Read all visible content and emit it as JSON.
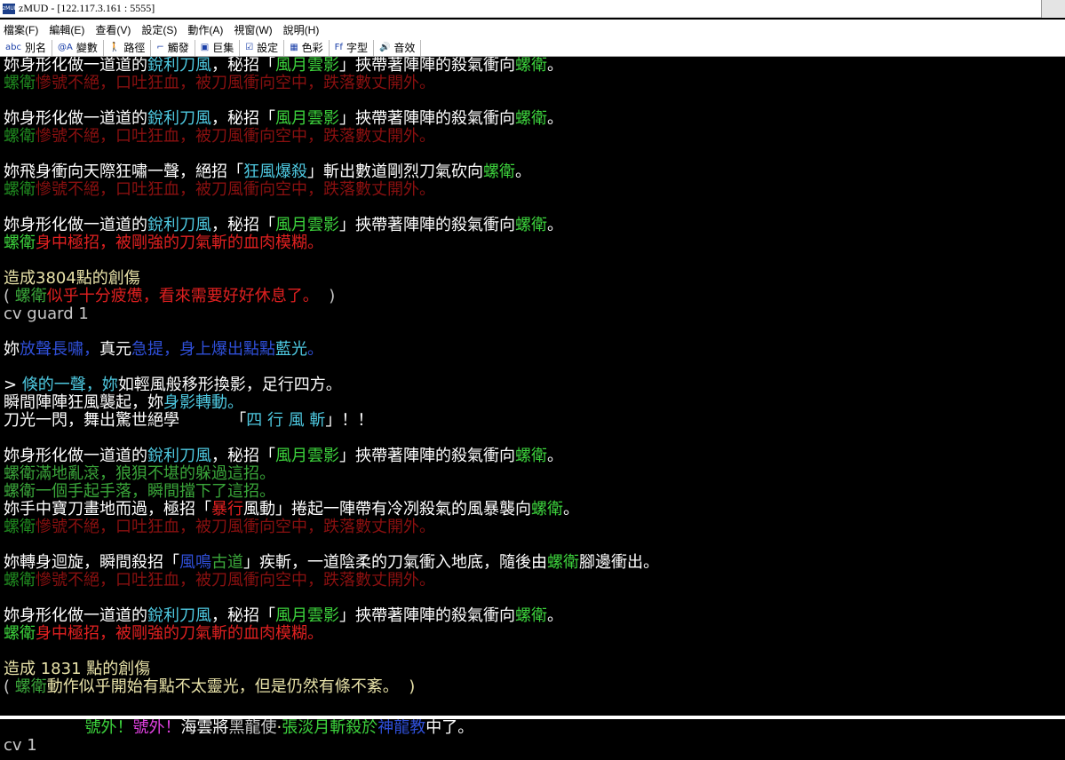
{
  "window": {
    "title": "zMUD - [122.117.3.161 : 5555]",
    "app_icon_text": "zMUD"
  },
  "menu": [
    {
      "label": "檔案(F)"
    },
    {
      "label": "編輯(E)"
    },
    {
      "label": "查看(V)"
    },
    {
      "label": "設定(S)"
    },
    {
      "label": "動作(A)"
    },
    {
      "label": "視窗(W)"
    },
    {
      "label": "說明(H)"
    }
  ],
  "toolbar": [
    {
      "name": "alias-button",
      "icon": "abc",
      "icon_name": "abc-icon",
      "label": "別名"
    },
    {
      "name": "variables-button",
      "icon": "@A",
      "icon_name": "at-a-icon",
      "label": "變數"
    },
    {
      "name": "paths-button",
      "icon": "🚶",
      "icon_name": "walker-icon",
      "label": "路徑"
    },
    {
      "name": "triggers-button",
      "icon": "⌐",
      "icon_name": "gun-icon",
      "label": "觸發"
    },
    {
      "name": "macros-button",
      "icon": "▣",
      "icon_name": "keyboard-icon",
      "label": "巨集"
    },
    {
      "name": "settings-button",
      "icon": "☑",
      "icon_name": "checkbox-icon",
      "label": "設定"
    },
    {
      "name": "colors-button",
      "icon": "▦",
      "icon_name": "color-grid-icon",
      "label": "色彩"
    },
    {
      "name": "fonts-button",
      "icon": "Ff",
      "icon_name": "font-icon",
      "label": "字型"
    },
    {
      "name": "sounds-button",
      "icon": "🔊",
      "icon_name": "speaker-icon",
      "label": "音效"
    }
  ],
  "colors": {
    "white": "#ffffff",
    "cyan": "#4ec8e0",
    "green_bright": "#3cd23c",
    "green": "#3aa63a",
    "darkgreen": "#1f8a1f",
    "red": "#e02020",
    "darkred": "#8a1010",
    "yellow": "#e8e2a8",
    "blue": "#2f4fd8",
    "magenta": "#e040e0",
    "grey": "#c8c8c8"
  },
  "terminal_lines": [
    [
      [
        "妳身形化做一道道的",
        "white"
      ],
      [
        "銳利刀風",
        "cyan"
      ],
      [
        "，秘招「",
        "white"
      ],
      [
        "風月雲影",
        "green_bright"
      ],
      [
        "」挾帶著陣陣的殺氣衝向",
        "white"
      ],
      [
        "螺衛",
        "green_bright"
      ],
      [
        "。",
        "white"
      ]
    ],
    [
      [
        "螺衛",
        "darkgreen"
      ],
      [
        "慘號不絕，口吐狂血，被刀風衝向空中，跌落數丈開外。",
        "darkred"
      ]
    ],
    [],
    [
      [
        "妳身形化做一道道的",
        "white"
      ],
      [
        "銳利刀風",
        "cyan"
      ],
      [
        "，秘招「",
        "white"
      ],
      [
        "風月雲影",
        "green_bright"
      ],
      [
        "」挾帶著陣陣的殺氣衝向",
        "white"
      ],
      [
        "螺衛",
        "green_bright"
      ],
      [
        "。",
        "white"
      ]
    ],
    [
      [
        "螺衛",
        "darkgreen"
      ],
      [
        "慘號不絕，口吐狂血，被刀風衝向空中，跌落數丈開外。",
        "darkred"
      ]
    ],
    [],
    [
      [
        "妳飛身衝向天際狂嘯一聲，絕招「",
        "white"
      ],
      [
        "狂風爆殺",
        "cyan"
      ],
      [
        "」斬出數道剛烈刀氣砍向",
        "white"
      ],
      [
        "螺衛",
        "green_bright"
      ],
      [
        "。",
        "white"
      ]
    ],
    [
      [
        "螺衛",
        "darkgreen"
      ],
      [
        "慘號不絕，口吐狂血，被刀風衝向空中，跌落數丈開外。",
        "darkred"
      ]
    ],
    [],
    [
      [
        "妳身形化做一道道的",
        "white"
      ],
      [
        "銳利刀風",
        "cyan"
      ],
      [
        "，秘招「",
        "white"
      ],
      [
        "風月雲影",
        "green_bright"
      ],
      [
        "」挾帶著陣陣的殺氣衝向",
        "white"
      ],
      [
        "螺衛",
        "green_bright"
      ],
      [
        "。",
        "white"
      ]
    ],
    [
      [
        "螺衛",
        "green_bright"
      ],
      [
        "身中極招，被剛強的刀氣斬的血肉模糊。",
        "red"
      ]
    ],
    [],
    [
      [
        "造成3804點的創傷",
        "yellow"
      ]
    ],
    [
      [
        "( ",
        "grey"
      ],
      [
        "螺衛",
        "green"
      ],
      [
        "似乎十分疲憊，看來需要好好休息了。",
        "red"
      ],
      [
        "  )",
        "grey"
      ]
    ],
    [
      [
        "cv guard 1",
        "grey"
      ]
    ],
    [],
    [
      [
        "妳",
        "white"
      ],
      [
        "放聲長嘯，",
        "blue"
      ],
      [
        "真元",
        "white"
      ],
      [
        "急提，身上爆出點點",
        "blue"
      ],
      [
        "藍光",
        "cyan"
      ],
      [
        "。",
        "blue"
      ]
    ],
    [],
    [
      [
        "> ",
        "white"
      ],
      [
        "倏的一聲，妳",
        "cyan"
      ],
      [
        "如輕風般移形換影，足行四方。",
        "white"
      ]
    ],
    [
      [
        "瞬間陣陣狂風襲起，妳",
        "white"
      ],
      [
        "身影轉動",
        "cyan"
      ],
      [
        "。",
        "cyan"
      ]
    ],
    [
      [
        "刀光一閃，舞出驚世絕學          「",
        "white"
      ],
      [
        "四 行 風 斬",
        "cyan"
      ],
      [
        "」！！",
        "white"
      ]
    ],
    [],
    [
      [
        "妳身形化做一道道的",
        "white"
      ],
      [
        "銳利刀風",
        "cyan"
      ],
      [
        "，秘招「",
        "white"
      ],
      [
        "風月雲影",
        "green_bright"
      ],
      [
        "」挾帶著陣陣的殺氣衝向",
        "white"
      ],
      [
        "螺衛",
        "green_bright"
      ],
      [
        "。",
        "white"
      ]
    ],
    [
      [
        "螺衛滿地亂滾，狼狽不堪的躲過這招。",
        "green"
      ]
    ],
    [
      [
        "螺衛一個手起手落，瞬間擋下了這招。",
        "green"
      ]
    ],
    [
      [
        "妳手中寶刀畫地而過，極招「",
        "white"
      ],
      [
        "暴行",
        "red"
      ],
      [
        "風動」捲起一陣帶有冷冽殺氣的風暴襲向",
        "white"
      ],
      [
        "螺衛",
        "green_bright"
      ],
      [
        "。",
        "white"
      ]
    ],
    [
      [
        "螺衛",
        "darkgreen"
      ],
      [
        "慘號不絕，口吐狂血，被刀風衝向空中，跌落數丈開外。",
        "darkred"
      ]
    ],
    [],
    [
      [
        "妳轉身迴旋，瞬間殺招「",
        "white"
      ],
      [
        "風鳴",
        "blue"
      ],
      [
        "古道",
        "green"
      ],
      [
        "」疾斬，一道陰柔的刀氣衝入地底，隨後由",
        "white"
      ],
      [
        "螺衛",
        "green_bright"
      ],
      [
        "腳邊衝出。",
        "white"
      ]
    ],
    [
      [
        "螺衛",
        "darkgreen"
      ],
      [
        "慘號不絕，口吐狂血，被刀風衝向空中，跌落數丈開外。",
        "darkred"
      ]
    ],
    [],
    [
      [
        "妳身形化做一道道的",
        "white"
      ],
      [
        "銳利刀風",
        "cyan"
      ],
      [
        "，秘招「",
        "white"
      ],
      [
        "風月雲影",
        "green_bright"
      ],
      [
        "」挾帶著陣陣的殺氣衝向",
        "white"
      ],
      [
        "螺衛",
        "green_bright"
      ],
      [
        "。",
        "white"
      ]
    ],
    [
      [
        "螺衛",
        "green_bright"
      ],
      [
        "身中極招，被剛強的刀氣斬的血肉模糊。",
        "red"
      ]
    ],
    [],
    [
      [
        "造成 1831 點的創傷",
        "yellow"
      ]
    ],
    [
      [
        "( ",
        "grey"
      ],
      [
        "螺衛",
        "green"
      ],
      [
        "動作似乎開始有點不太靈光，但是仍然有條不紊。  )",
        "yellow"
      ]
    ]
  ],
  "status_lines": [
    [
      [
        "                ",
        "white"
      ],
      [
        "號外！",
        "green_bright"
      ],
      [
        "號外！",
        "magenta"
      ],
      [
        "海雲將",
        "white"
      ],
      [
        "黑龍使",
        "grey"
      ],
      [
        "·",
        "yellow"
      ],
      [
        "張淡月斬殺於",
        "green_bright"
      ],
      [
        "神龍教",
        "blue"
      ],
      [
        "中了。",
        "white"
      ]
    ],
    [
      [
        "cv 1",
        "grey"
      ]
    ]
  ]
}
